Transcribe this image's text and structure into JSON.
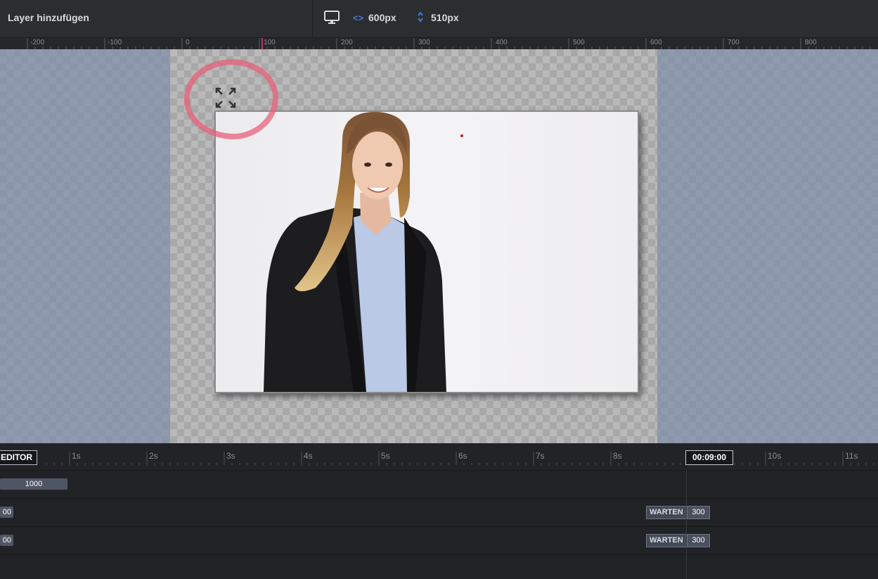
{
  "toolbar": {
    "add_layer_label": "Layer hinzufügen",
    "device_icon": "monitor-icon",
    "width_icon": "code-arrows-icon",
    "width_value": "600px",
    "height_icon": "vertical-chevrons-icon",
    "height_value": "510px",
    "accent_color": "#3f7be0"
  },
  "ruler": {
    "labels": [
      "-200",
      "-100",
      "0",
      "100",
      "200",
      "300",
      "400",
      "500",
      "600",
      "700",
      "800"
    ]
  },
  "canvas": {
    "photo_description_icon": "expand-icon",
    "annotation_color": "#e8607a"
  },
  "timeline": {
    "editor_label": "EDITOR",
    "seconds": [
      "1s",
      "2s",
      "3s",
      "4s",
      "5s",
      "6s",
      "7s",
      "8s",
      "10s",
      "11s"
    ],
    "current_time": "00:09:00",
    "rows": [
      {
        "bar_value": "1000"
      },
      {
        "bar_value": "00",
        "wait_label": "WARTEN",
        "wait_value": "300"
      },
      {
        "bar_value": "00",
        "wait_label": "WARTEN",
        "wait_value": "300"
      }
    ]
  }
}
